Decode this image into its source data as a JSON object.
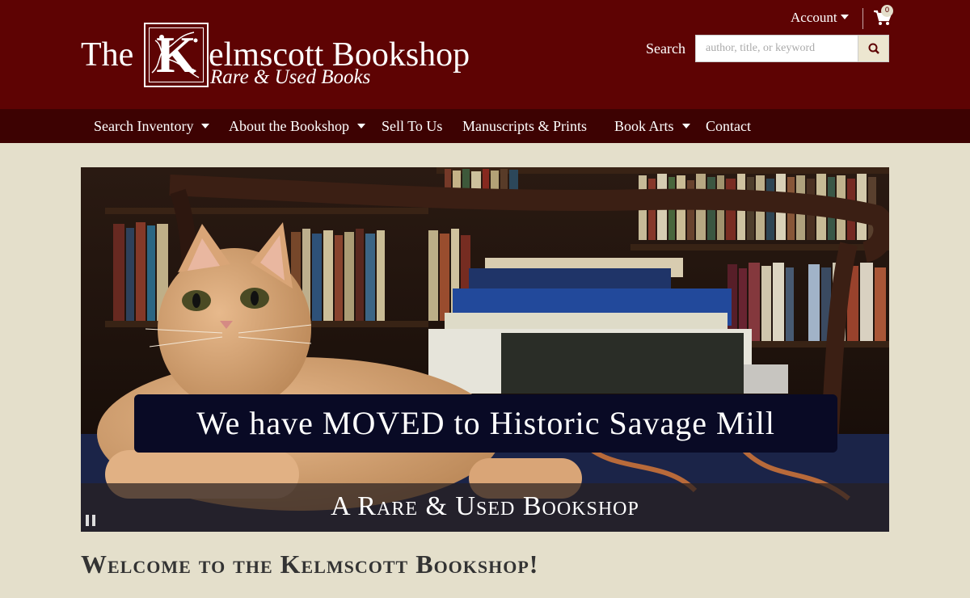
{
  "header": {
    "logo": {
      "the": "The",
      "initial": "K",
      "name": "elmscott Bookshop",
      "tagline": "Rare & Used Books"
    },
    "account_label": "Account",
    "cart_count": "0",
    "search": {
      "label": "Search",
      "placeholder": "author, title, or keyword"
    }
  },
  "nav": {
    "items": [
      {
        "label": "Search Inventory",
        "dropdown": true
      },
      {
        "label": "About the Bookshop",
        "dropdown": true
      },
      {
        "label": "Sell To Us",
        "dropdown": false
      },
      {
        "label": "Manuscripts & Prints",
        "dropdown": false
      },
      {
        "label": "Book Arts",
        "dropdown": true
      },
      {
        "label": "Contact",
        "dropdown": false
      }
    ]
  },
  "hero": {
    "banner_text": "We have MOVED to Historic Savage Mill",
    "subtitle": "A Rare & Used Bookshop"
  },
  "main": {
    "welcome": "Welcome to the Kelmscott Bookshop!"
  },
  "colors": {
    "header_bg": "#5e0303",
    "nav_bg": "#3d0202",
    "page_bg": "#e4dfcb",
    "banner_bg": "#090a25"
  }
}
